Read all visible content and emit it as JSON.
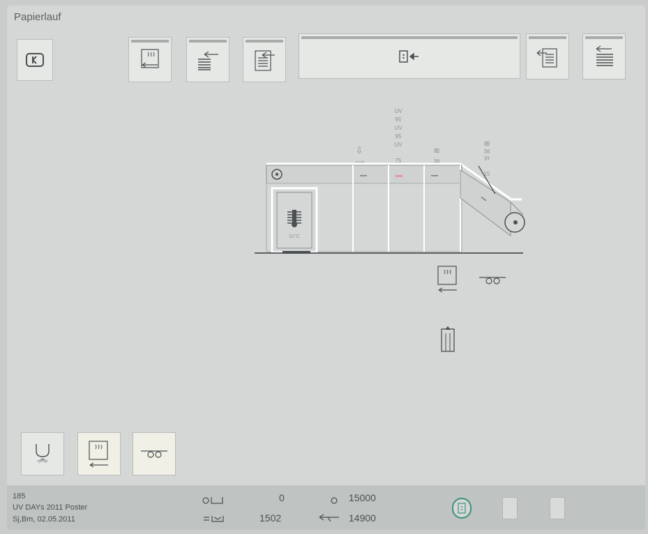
{
  "window": {
    "title": "Papierlauf"
  },
  "toolbar": {
    "buttons": [
      {
        "name": "back-button",
        "icon": "back-icon"
      },
      {
        "name": "dryer-return-button",
        "icon": "dryer-return-icon"
      },
      {
        "name": "sheet-return-button",
        "icon": "sheet-return-icon"
      },
      {
        "name": "stack-return-button",
        "icon": "stack-return-icon"
      },
      {
        "name": "door-feed-button",
        "icon": "door-feed-icon"
      },
      {
        "name": "pile-return-button",
        "icon": "pile-return-icon"
      },
      {
        "name": "sheet-delivery-button",
        "icon": "sheet-delivery-icon"
      }
    ]
  },
  "machine": {
    "stations": [
      {
        "symbol": "⇩",
        "value": "100"
      },
      {
        "stack": [
          "UV",
          "95",
          "UV",
          "95",
          "UV"
        ],
        "value": "75"
      },
      {
        "symbol": "≋",
        "value": "36"
      },
      {
        "symbol": "≋",
        "stack": [
          "36",
          "IR"
        ],
        "value": "15"
      }
    ],
    "pile_temp": "31°C"
  },
  "bottom_left_buttons": [
    {
      "name": "powder-button",
      "icon": "powder-icon"
    },
    {
      "name": "dryer-button",
      "icon": "dryer-icon"
    },
    {
      "name": "roller-button",
      "icon": "roller-icon"
    }
  ],
  "status": {
    "job_number": "185",
    "job_name": "UV DAYs 2011 Poster",
    "job_info": "Sj,Bm, 02.05.2011",
    "counter1_value": "0",
    "counter2_value": "1502",
    "target_value": "15000",
    "speed_value": "14900"
  },
  "colors": {
    "screen_bg": "#d4d7d6",
    "button_bg": "#e6e8e5",
    "button_lit": "#f1f0e6",
    "uv_highlight": "#e58fc3",
    "status_bg": "#bfc3c2"
  }
}
